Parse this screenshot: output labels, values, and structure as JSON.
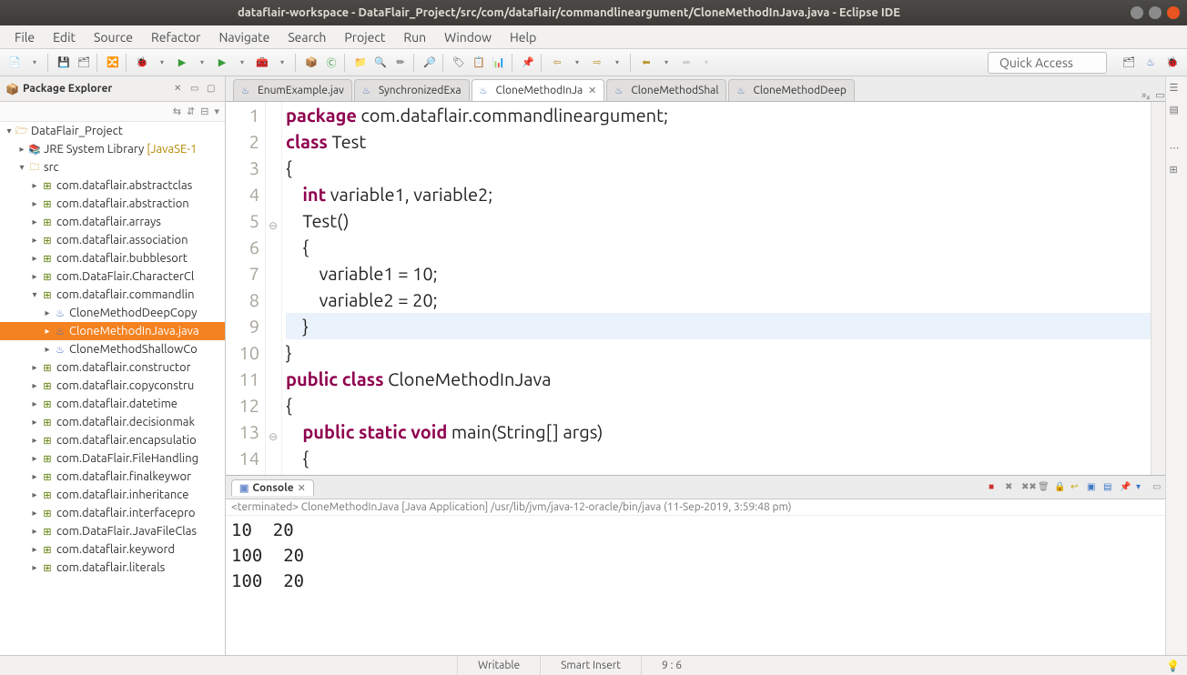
{
  "window": {
    "title": "dataflair-workspace - DataFlair_Project/src/com/dataflair/commandlineargument/CloneMethodInJava.java - Eclipse IDE"
  },
  "menu": {
    "items": [
      "File",
      "Edit",
      "Source",
      "Refactor",
      "Navigate",
      "Search",
      "Project",
      "Run",
      "Window",
      "Help"
    ]
  },
  "quick_access": "Quick Access",
  "pkg_explorer": {
    "title": "Package Explorer",
    "project": "DataFlair_Project",
    "jre": {
      "label": "JRE System Library",
      "suffix": "[JavaSE-1"
    },
    "src": "src",
    "packages_top": [
      "com.dataflair.abstractclas",
      "com.dataflair.abstraction",
      "com.dataflair.arrays",
      "com.dataflair.association",
      "com.dataflair.bubblesort",
      "com.DataFlair.CharacterCl"
    ],
    "open_pkg": "com.dataflair.commandlin",
    "open_pkg_children": [
      "CloneMethodDeepCopy",
      "CloneMethodInJava.java",
      "CloneMethodShallowCo"
    ],
    "packages_bottom": [
      "com.dataflair.constructor",
      "com.dataflair.copyconstru",
      "com.dataflair.datetime",
      "com.dataflair.decisionmak",
      "com.dataflair.encapsulatio",
      "com.DataFlair.FileHandling",
      "com.dataflair.finalkeywor",
      "com.dataflair.inheritance",
      "com.dataflair.interfacepro",
      "com.DataFlair.JavaFileClas",
      "com.dataflair.keyword",
      "com.dataflair.literals"
    ]
  },
  "editor_tabs": [
    {
      "label": "EnumExample.jav",
      "active": false
    },
    {
      "label": "SynchronizedExa",
      "active": false
    },
    {
      "label": "CloneMethodInJa",
      "active": true
    },
    {
      "label": "CloneMethodShal",
      "active": false
    },
    {
      "label": "CloneMethodDeep",
      "active": false
    }
  ],
  "editor_tabs_overflow": "»₄",
  "code": {
    "lines": [
      {
        "n": 1,
        "html": "<span class='kw'>package</span> com.dataflair.commandlineargument;"
      },
      {
        "n": 2,
        "html": "<span class='kw'>class</span> Test"
      },
      {
        "n": 3,
        "html": "{"
      },
      {
        "n": 4,
        "html": "    <span class='kw'>int</span> variable1, variable2;"
      },
      {
        "n": 5,
        "html": "    Test()",
        "marker": "⊖"
      },
      {
        "n": 6,
        "html": "    {"
      },
      {
        "n": 7,
        "html": "        variable1 = 10;"
      },
      {
        "n": 8,
        "html": "        variable2 = 20;"
      },
      {
        "n": 9,
        "html": "    }",
        "hl": true
      },
      {
        "n": 10,
        "html": "}"
      },
      {
        "n": 11,
        "html": "<span class='kw'>public</span> <span class='kw'>class</span> CloneMethodInJava"
      },
      {
        "n": 12,
        "html": "{"
      },
      {
        "n": 13,
        "html": "    <span class='kw'>public</span> <span class='kw'>static</span> <span class='kw'>void</span> main(String[] args)",
        "marker": "⊖"
      },
      {
        "n": 14,
        "html": "    {"
      }
    ]
  },
  "console": {
    "title": "Console",
    "status": "<terminated> CloneMethodInJava [Java Application] /usr/lib/jvm/java-12-oracle/bin/java (11-Sep-2019, 3:59:48 pm)",
    "output": "10  20\n100  20\n100  20"
  },
  "statusbar": {
    "writable": "Writable",
    "insert": "Smart Insert",
    "pos": "9 : 6"
  }
}
